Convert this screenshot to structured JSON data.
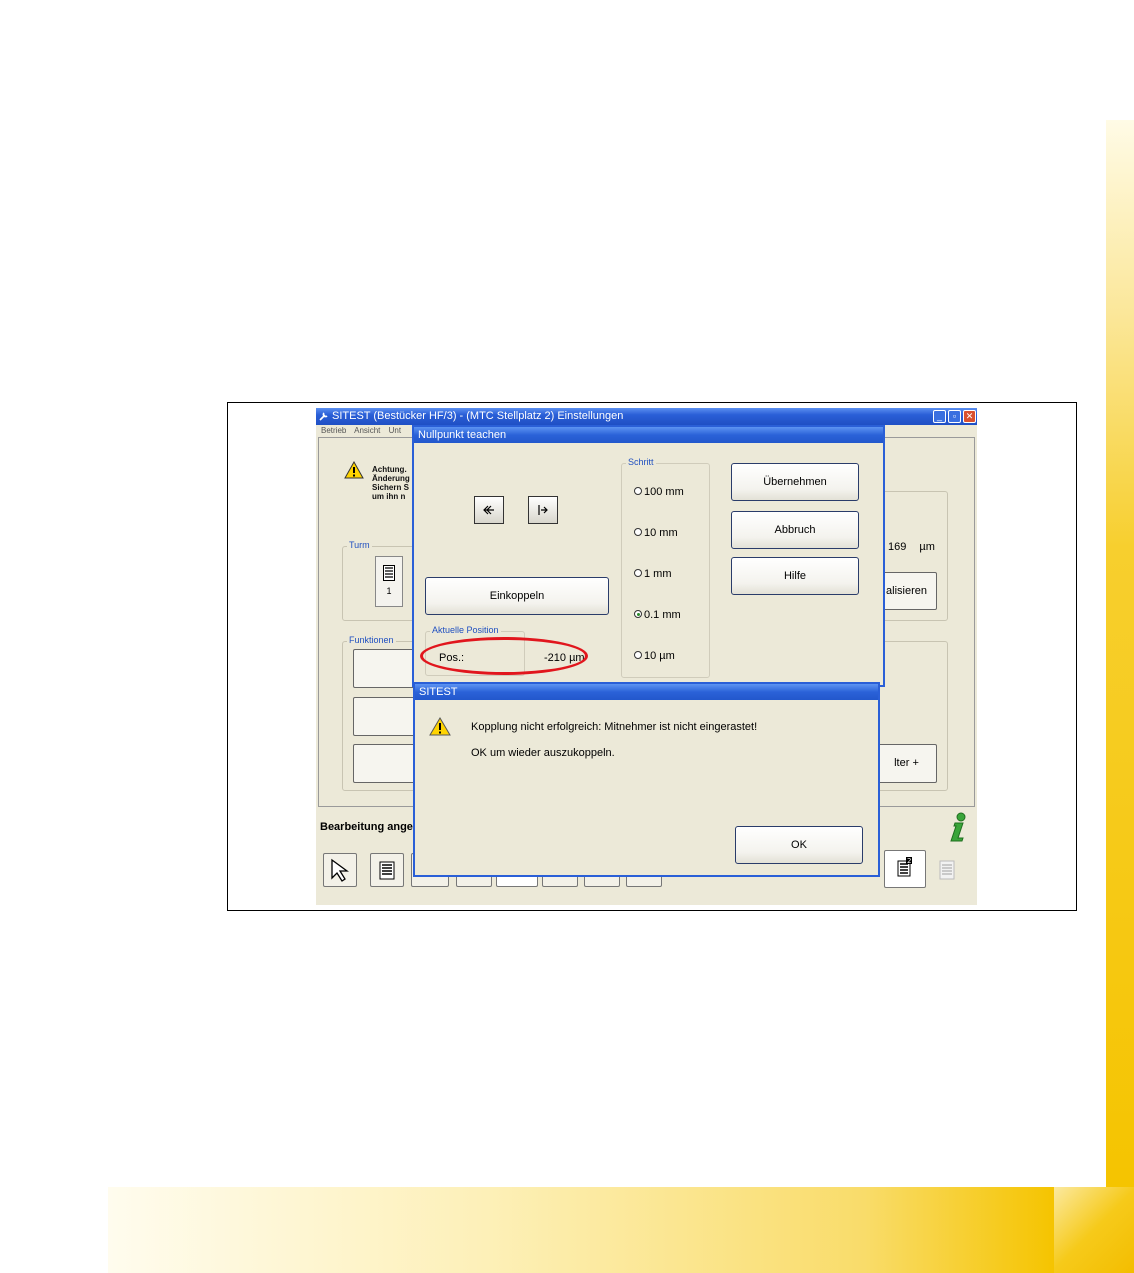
{
  "window": {
    "title": "SITEST (Bestücker HF/3) - (MTC Stellplatz 2) Einstellungen",
    "menu": [
      "Betrieb",
      "Ansicht",
      "Unt"
    ],
    "controls": {
      "minimize": "_",
      "restore": "▫",
      "close": "✕"
    }
  },
  "background_panel": {
    "warning_lines": [
      "Achtung.",
      "Änderung",
      "Sichern S",
      "um ihn n"
    ],
    "turm_label": "Turm",
    "turm_number": "1",
    "funktionen_label": "Funktionen",
    "value": "169",
    "unit": "µm",
    "btn_aktualisieren": "alisieren",
    "btn_halter": "lter +",
    "status": "Bearbeitung angel"
  },
  "nullpunkt_dialog": {
    "title": "Nullpunkt teachen",
    "schritt_label": "Schritt",
    "steps": [
      {
        "label": "100 mm",
        "checked": false
      },
      {
        "label": "10 mm",
        "checked": false
      },
      {
        "label": "1 mm",
        "checked": false
      },
      {
        "label": "0.1 mm",
        "checked": true
      },
      {
        "label": "10 µm",
        "checked": false
      }
    ],
    "btn_uebernehmen": "Übernehmen",
    "btn_abbruch": "Abbruch",
    "btn_hilfe": "Hilfe",
    "btn_einkoppeln": "Einkoppeln",
    "position_group": "Aktuelle Position",
    "pos_label": "Pos.:",
    "pos_value": "-210 µm"
  },
  "sitest_dialog": {
    "title": "SITEST",
    "message_line1": "Kopplung nicht erfolgreich: Mitnehmer ist nicht eingerastet!",
    "message_line2": "OK um wieder auszukoppeln.",
    "btn_ok": "OK"
  },
  "colors": {
    "xp_blue": "#2a5fd7",
    "highlight_red": "#e1161d",
    "page_yellow": "#f5c400"
  }
}
